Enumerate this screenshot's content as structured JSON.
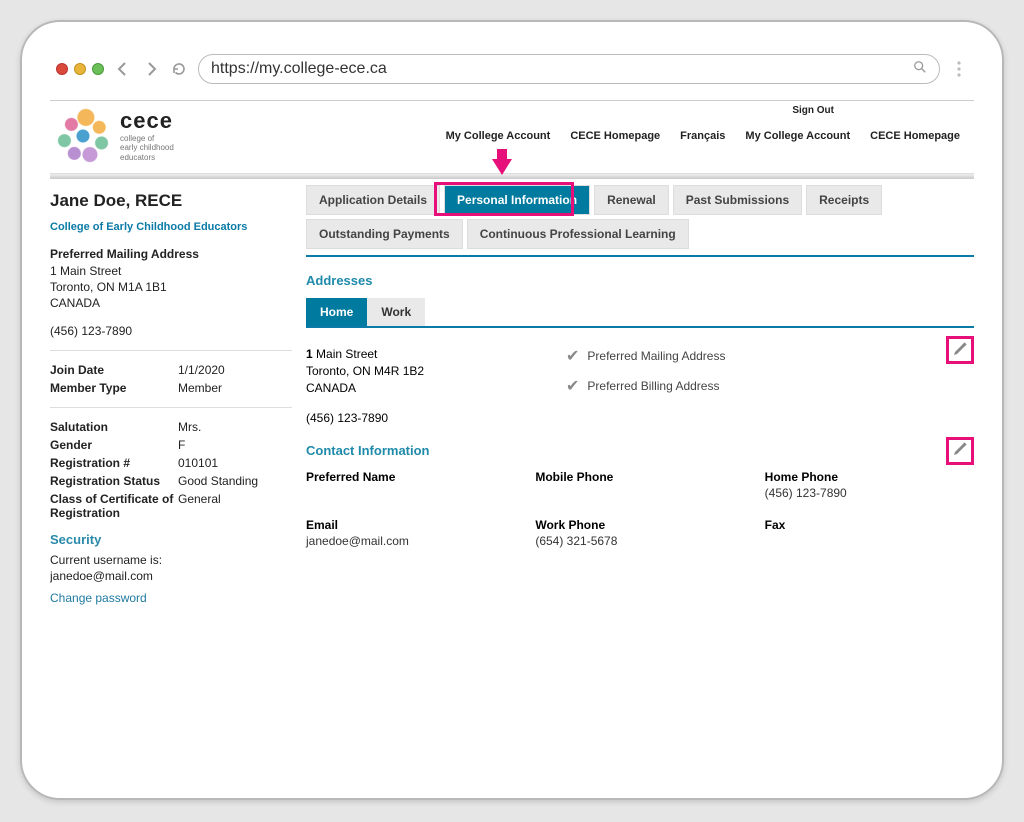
{
  "browser": {
    "url": "https://my.college-ece.ca"
  },
  "brand": {
    "name": "cece",
    "tagline": "college of\nearly childhood\neducators"
  },
  "header": {
    "sign_out": "Sign Out",
    "links": [
      "My College Account",
      "CECE Homepage",
      "Français",
      "My College Account",
      "CECE Homepage"
    ]
  },
  "sidebar": {
    "name": "Jane Doe, RECE",
    "org_link": "College of Early Childhood Educators",
    "mailing_title": "Preferred Mailing Address",
    "mailing": {
      "street": "1 Main Street",
      "city_line": "Toronto, ON  M1A 1B1",
      "country": "CANADA"
    },
    "phone": "(456) 123-7890",
    "join_date_label": "Join Date",
    "join_date": "1/1/2020",
    "member_type_label": "Member Type",
    "member_type": "Member",
    "salutation_label": "Salutation",
    "salutation": "Mrs.",
    "gender_label": "Gender",
    "gender": "F",
    "reg_no_label": "Registration #",
    "reg_no": "010101",
    "reg_status_label": "Registration Status",
    "reg_status": "Good Standing",
    "class_label": "Class of Certificate of Registration",
    "class_value": "General",
    "security_title": "Security",
    "username_label": "Current username is:",
    "username": "janedoe@mail.com",
    "change_pw": "Change password"
  },
  "tabs": {
    "items": [
      "Application Details",
      "Personal Information",
      "Renewal",
      "Past Submissions",
      "Receipts",
      "Outstanding Payments",
      "Continuous Professional Learning"
    ]
  },
  "addresses": {
    "title": "Addresses",
    "subtabs": [
      "Home",
      "Work"
    ],
    "home": {
      "number": "1",
      "street": "Main Street",
      "city_line": "Toronto, ON  M4R 1B2",
      "country": "CANADA",
      "phone": "(456) 123-7890",
      "pref_mail": "Preferred Mailing Address",
      "pref_bill": "Preferred Billing Address"
    }
  },
  "contact": {
    "title": "Contact Information",
    "preferred_name_label": "Preferred Name",
    "preferred_name": "",
    "mobile_label": "Mobile Phone",
    "mobile": "",
    "home_label": "Home Phone",
    "home": "(456) 123-7890",
    "email_label": "Email",
    "email": "janedoe@mail.com",
    "work_label": "Work Phone",
    "work": "(654) 321-5678",
    "fax_label": "Fax",
    "fax": ""
  }
}
